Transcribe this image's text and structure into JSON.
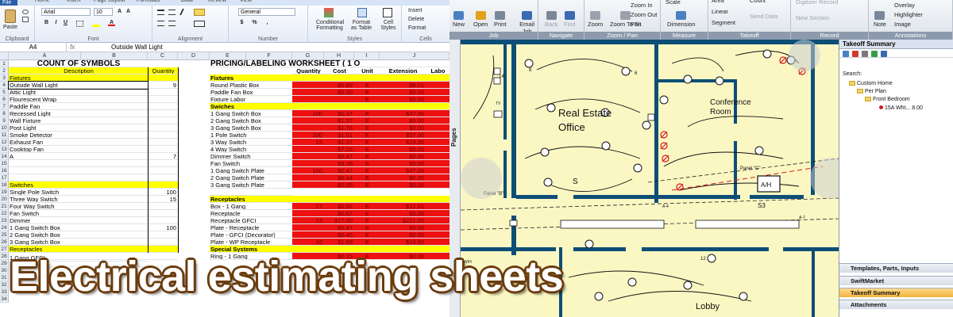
{
  "excel": {
    "tabs": [
      "File",
      "Home",
      "Insert",
      "Page Layout",
      "Formulas",
      "Data",
      "Review",
      "View"
    ],
    "clipboard": {
      "paste": "Paste",
      "label": "Clipboard"
    },
    "font": {
      "name": "Arial",
      "size": "10",
      "label": "Font"
    },
    "alignment": {
      "label": "Alignment"
    },
    "number": {
      "format": "General",
      "label": "Number"
    },
    "styles": {
      "cond": "Conditional Formatting",
      "table": "Format as Table",
      "cell": "Cell Styles",
      "label": "Styles"
    },
    "cells": {
      "insert": "Insert",
      "delete": "Delete",
      "format": "Format",
      "label": "Cells"
    },
    "name_box": "A4",
    "fx": "fx",
    "formula_value": "Outside Wall Light",
    "columns": [
      "A",
      "B",
      "C",
      "D",
      "E",
      "F",
      "G",
      "H",
      "I",
      "J"
    ],
    "rows": [
      "1",
      "2",
      "3",
      "4",
      "5",
      "6",
      "7",
      "8",
      "9",
      "10",
      "11",
      "12",
      "13",
      "14",
      "15",
      "16",
      "17",
      "18",
      "19",
      "20",
      "21",
      "22",
      "23",
      "24",
      "25",
      "26",
      "27",
      "28",
      "29",
      "30",
      "31",
      "32",
      "33",
      "34"
    ],
    "left_title": "COUNT OF SYMBOLS",
    "left_headers": [
      "Description",
      "Quantity"
    ],
    "left_rows": [
      {
        "label": "Fixtures",
        "qty": "",
        "style": "yellow"
      },
      {
        "label": "Outside Wall Light",
        "qty": "9",
        "style": ""
      },
      {
        "label": "Attic Light",
        "qty": "",
        "style": ""
      },
      {
        "label": "Flourescent Wrap",
        "qty": "",
        "style": ""
      },
      {
        "label": "Paddle Fan",
        "qty": "",
        "style": ""
      },
      {
        "label": "Recessed Light",
        "qty": "",
        "style": ""
      },
      {
        "label": "Wall Fixture",
        "qty": "",
        "style": ""
      },
      {
        "label": "Post Light",
        "qty": "",
        "style": ""
      },
      {
        "label": "Smoke Detector",
        "qty": "",
        "style": ""
      },
      {
        "label": "Exhaust Fan",
        "qty": "",
        "style": ""
      },
      {
        "label": "Cooktop Fan",
        "qty": "",
        "style": ""
      },
      {
        "label": "A",
        "qty": "7",
        "style": ""
      },
      {
        "label": "",
        "qty": "",
        "style": ""
      },
      {
        "label": "",
        "qty": "",
        "style": ""
      },
      {
        "label": "",
        "qty": "",
        "style": ""
      },
      {
        "label": "Switches",
        "qty": "",
        "style": "yellow"
      },
      {
        "label": "Single Pole Switch",
        "qty": "100",
        "style": ""
      },
      {
        "label": "Three Way Switch",
        "qty": "15",
        "style": ""
      },
      {
        "label": "Four Way Switch",
        "qty": "",
        "style": ""
      },
      {
        "label": "Fan Switch",
        "qty": "",
        "style": ""
      },
      {
        "label": "Dimmer",
        "qty": "",
        "style": ""
      },
      {
        "label": "1 Gang Switch Box",
        "qty": "100",
        "style": ""
      },
      {
        "label": "2 Gang Switch Box",
        "qty": "",
        "style": ""
      },
      {
        "label": "3 Gang Switch Box",
        "qty": "",
        "style": ""
      },
      {
        "label": "Receptacles",
        "qty": "",
        "style": "yellow"
      },
      {
        "label": "",
        "qty": "",
        "style": ""
      },
      {
        "label": "",
        "qty": "",
        "style": ""
      }
    ],
    "right_title": "PRICING/LABELING WORKSHEET ( 1 O",
    "right_headers": [
      "Quantity",
      "Cost",
      "Unit",
      "Extension",
      "Labo"
    ],
    "right_rows": [
      {
        "label": "Fixtures",
        "q": "",
        "c": "",
        "u": "",
        "e": "",
        "style": "section"
      },
      {
        "label": "Round Plastic Box",
        "q": "",
        "c": "$0.89",
        "u": "E",
        "e": "$8.01",
        "style": "red"
      },
      {
        "label": "Paddle Fan Box",
        "q": "",
        "c": "$0.00",
        "u": "E",
        "e": "$0.00",
        "style": "red"
      },
      {
        "label": "Fixture Labor",
        "q": "",
        "c": "",
        "u": "E",
        "e": "$0.00",
        "style": "red"
      },
      {
        "label": "Swiches",
        "q": "",
        "c": "",
        "u": "",
        "e": "",
        "style": "section"
      },
      {
        "label": "1 Gang Switch Box",
        "q": "100",
        "c": "$0.37",
        "u": "E",
        "e": "$37.00",
        "style": "red"
      },
      {
        "label": "2 Gang Switch Box",
        "q": "",
        "c": "$1.57",
        "u": "E",
        "e": "$0.00",
        "style": "red"
      },
      {
        "label": "3 Gang Switch Box",
        "q": "",
        "c": "$1.78",
        "u": "E",
        "e": "$0.00",
        "style": "red"
      },
      {
        "label": "1 Pole Switch",
        "q": "100",
        "c": "$1.51",
        "u": "E",
        "e": "$57.00",
        "style": "red"
      },
      {
        "label": "3 Way Switch",
        "q": "15",
        "c": "$1.27",
        "u": "E",
        "e": "$19.05",
        "style": "red"
      },
      {
        "label": "4 Way Switch",
        "q": "",
        "c": "$7.15",
        "u": "E",
        "e": "$0.00",
        "style": "red"
      },
      {
        "label": "Dimmer Switch",
        "q": "",
        "c": "$5.47",
        "u": "E",
        "e": "$0.00",
        "style": "red"
      },
      {
        "label": "Fan Switch",
        "q": "",
        "c": "$9.38",
        "u": "E",
        "e": "$0.00",
        "style": "red"
      },
      {
        "label": "1 Gang Switch Plate",
        "q": "100",
        "c": "$0.47",
        "u": "E",
        "e": "$47.00",
        "style": "red"
      },
      {
        "label": "2 Gang Switch Plate",
        "q": "",
        "c": "$0.44",
        "u": "E",
        "e": "$0.00",
        "style": "red"
      },
      {
        "label": "3 Gang Switch Plate",
        "q": "",
        "c": "$0.95",
        "u": "E",
        "e": "$0.00",
        "style": "red"
      },
      {
        "label": "",
        "q": "",
        "c": "",
        "u": "",
        "e": "",
        "style": ""
      },
      {
        "label": "Receptacles",
        "q": "",
        "c": "",
        "u": "",
        "e": "",
        "style": "section"
      },
      {
        "label": "Box - 1 Gang",
        "q": "17",
        "c": "$0.92",
        "u": "E",
        "e": "$12.61",
        "style": "red"
      },
      {
        "label": "Receptacle",
        "q": "",
        "c": "$0.67",
        "u": "E",
        "e": "$0.00",
        "style": "red"
      },
      {
        "label": "Receptacle GFCI",
        "q": "13",
        "c": "$17.00",
        "u": "E",
        "e": "$221.00",
        "style": "red"
      },
      {
        "label": "Plate - Receptacle",
        "q": "",
        "c": "$0.47",
        "u": "E",
        "e": "$0.00",
        "style": "red"
      },
      {
        "label": "Plate - GFCI (Decorator)",
        "q": "",
        "c": "$0.45",
        "u": "E",
        "e": "$0.00",
        "style": "red"
      },
      {
        "label": "Plate - WP Receptacle",
        "q": "10",
        "c": "$1.99",
        "u": "E",
        "e": "$19.90",
        "style": "red"
      },
      {
        "label": "Special Systems",
        "q": "",
        "c": "",
        "u": "",
        "e": "",
        "style": "section"
      },
      {
        "label": "Ring - 1 Gang",
        "q": "",
        "c": "$0.33",
        "u": "E",
        "e": "$0.00",
        "style": "red"
      }
    ],
    "receptacles_row_label": "1 Gang GFCI"
  },
  "plan": {
    "groups": [
      {
        "cap": "Job",
        "buttons": [
          "New",
          "Open",
          "Print",
          "Email Job"
        ]
      },
      {
        "cap": "Navigate",
        "buttons": [
          "Back",
          "Find"
        ]
      },
      {
        "cap": "Zoom / Pan",
        "buttons": [
          "Zoom",
          "Zoom To Fit"
        ],
        "small": [
          "Zoom In",
          "Zoom Out",
          "Pan"
        ]
      },
      {
        "cap": "Measure",
        "buttons": [
          "Dimension"
        ],
        "small": [
          "Scale"
        ]
      },
      {
        "cap": "Takeoff",
        "small": [
          "Area",
          "Linear",
          "Segment",
          "Count",
          "Send Data"
        ]
      },
      {
        "cap": "Record",
        "small": [
          "Digitizer Record",
          "New Section"
        ]
      },
      {
        "cap": "Annotations",
        "buttons": [
          "Note"
        ],
        "small": [
          "Overlay",
          "Highlighter",
          "Image"
        ]
      }
    ],
    "pages_tab": "Pages",
    "rooms": [
      "Real Estate Office",
      "Conference Room",
      "Lobby"
    ],
    "labels": [
      "Panel \"B\"",
      "Panel \"C\"",
      "A/H",
      "TV",
      "W/H",
      "S",
      "S3",
      "A-7",
      "A-4"
    ],
    "numbers": [
      "14",
      "12",
      "11",
      "8",
      "6",
      "9",
      "2",
      "4"
    ],
    "summary": {
      "title": "Takeoff Summary",
      "search": "Search:",
      "tree": [
        "Custom Home",
        "Per Plan",
        "Front Bedroom",
        "15A Wht... 8.00"
      ],
      "panels": [
        "Templates, Parts, Inputs",
        "SwiftMarket",
        "Takeoff Summary",
        "Attachments"
      ]
    }
  },
  "caption": "Electrical estimating sheets",
  "colors": {
    "excel_red": "#ee1111",
    "excel_yellow": "#ffff00",
    "plan_bg": "#fbf7c3",
    "wall": "#0d4e77",
    "caption_outline": "#6b3c0e"
  }
}
